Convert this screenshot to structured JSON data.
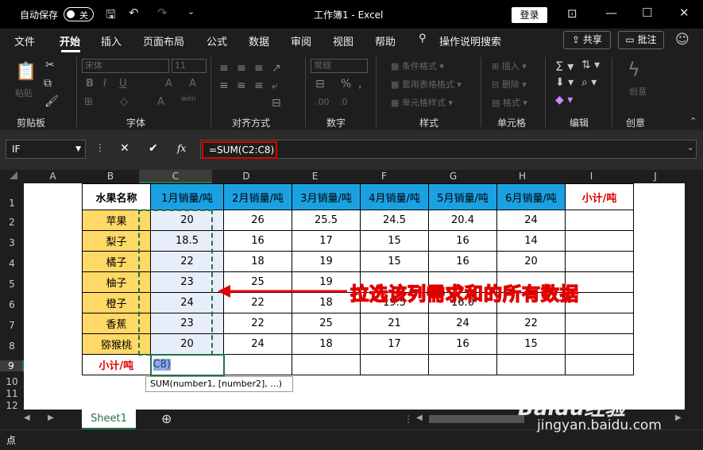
{
  "titlebar": {
    "autosave": "自动保存",
    "toggle": "关",
    "doc_title": "工作簿1  -  Excel",
    "login": "登录"
  },
  "tabs": [
    "文件",
    "开始",
    "插入",
    "页面布局",
    "公式",
    "数据",
    "审阅",
    "视图",
    "帮助",
    "操作说明搜索"
  ],
  "share": "共享",
  "comments": "批注",
  "ribbon": {
    "paste": "粘贴",
    "font": "宋体",
    "size": "11",
    "number_format": "常规",
    "cond_fmt": "条件格式",
    "table_fmt": "套用表格格式",
    "cell_style": "单元格样式",
    "insert": "插入",
    "delete": "删除",
    "format": "格式",
    "create": "创意",
    "groups": [
      "剪贴板",
      "字体",
      "对齐方式",
      "数字",
      "样式",
      "单元格",
      "编辑",
      "创意"
    ]
  },
  "namebox": "IF",
  "fx": "fx",
  "formula": "=SUM(C2:C8)",
  "columns": [
    "A",
    "B",
    "C",
    "D",
    "E",
    "F",
    "G",
    "H",
    "I",
    "J"
  ],
  "rows": [
    "1",
    "2",
    "3",
    "4",
    "5",
    "6",
    "7",
    "8",
    "9",
    "10",
    "11",
    "12"
  ],
  "table": {
    "header": [
      "水果名称",
      "1月销量/吨",
      "2月销量/吨",
      "3月销量/吨",
      "4月销量/吨",
      "5月销量/吨",
      "6月销量/吨",
      "小计/吨"
    ],
    "rows": [
      [
        "苹果",
        "20",
        "26",
        "25.5",
        "24.5",
        "20.4",
        "24",
        ""
      ],
      [
        "梨子",
        "18.5",
        "16",
        "17",
        "15",
        "16",
        "14",
        ""
      ],
      [
        "橘子",
        "22",
        "18",
        "19",
        "15",
        "16",
        "20",
        ""
      ],
      [
        "柚子",
        "23",
        "25",
        "19",
        "",
        "",
        "",
        ""
      ],
      [
        "橙子",
        "24",
        "22",
        "18",
        "19.5",
        "16.0",
        "",
        ""
      ],
      [
        "香蕉",
        "23",
        "22",
        "25",
        "21",
        "24",
        "22",
        ""
      ],
      [
        "猕猴桃",
        "20",
        "24",
        "18",
        "17",
        "16",
        "15",
        ""
      ]
    ],
    "footer": [
      "小计/吨",
      "C8)"
    ]
  },
  "hint": "SUM(number1, [number2], ...)",
  "annotation": "拉选该列需求和的所有数据",
  "sheet_tab": "Sheet1",
  "status": "点",
  "watermark": "Baidu经验",
  "watermark2": "jingyan.baidu.com"
}
